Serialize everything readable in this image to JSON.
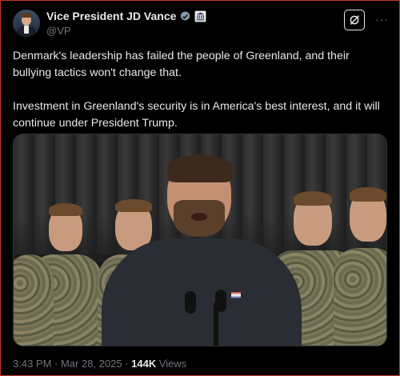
{
  "post": {
    "author": {
      "display_name": "Vice President JD Vance",
      "handle": "@VP",
      "verified_badge_icon": "gray-verified-badge-icon",
      "affiliate_icon": "government-building-icon"
    },
    "text_paragraphs": [
      "Denmark's leadership has failed the people of Greenland, and their bullying tactics won't change that.",
      "Investment in Greenland's security is in America's best interest, and it will continue under President Trump."
    ],
    "media": {
      "type": "video-frame"
    },
    "timestamp": "3:43 PM · Mar 28, 2025 · ",
    "views_count": "144K",
    "views_label": " Views"
  },
  "actions": {
    "grok_icon": "grok-icon",
    "more_icon": "more-options-icon",
    "more_label": "···"
  },
  "colors": {
    "background": "#000000",
    "text_primary": "#e7e9ea",
    "text_secondary": "#71767b",
    "badge_gray": "#829aab",
    "border": "#2f3336"
  }
}
